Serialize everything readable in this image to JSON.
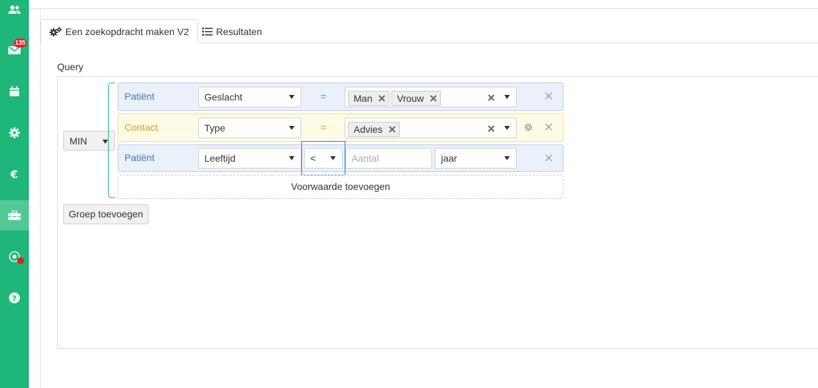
{
  "sidebar": {
    "items": [
      {
        "icon": "users-icon"
      },
      {
        "icon": "mail-icon",
        "badge": "135"
      },
      {
        "icon": "calendar-icon"
      },
      {
        "icon": "gear-icon"
      },
      {
        "icon": "euro-icon"
      },
      {
        "icon": "toolbox-icon",
        "active": true
      },
      {
        "icon": "location-icon"
      },
      {
        "icon": "help-icon"
      }
    ],
    "accent": "#1fb67a"
  },
  "tabs": [
    {
      "label": "Een zoekopdracht maken V2",
      "icon": "gears-icon",
      "active": true
    },
    {
      "label": "Resultaten",
      "icon": "list-icon"
    }
  ],
  "query": {
    "label": "Query",
    "group_operator": "MIN",
    "rows": [
      {
        "entity": "Patiënt",
        "field": "Geslacht",
        "operator": "=",
        "values": [
          "Man",
          "Vrouw"
        ]
      },
      {
        "entity": "Contact",
        "field": "Type",
        "operator": "=",
        "values": [
          "Advies"
        ]
      },
      {
        "entity": "Patiënt",
        "field": "Leeftijd",
        "operator": "<",
        "amount_placeholder": "Aantal",
        "unit": "jaar"
      }
    ],
    "add_condition_label": "Voorwaarde toevoegen",
    "add_group_label": "Groep toevoegen"
  }
}
